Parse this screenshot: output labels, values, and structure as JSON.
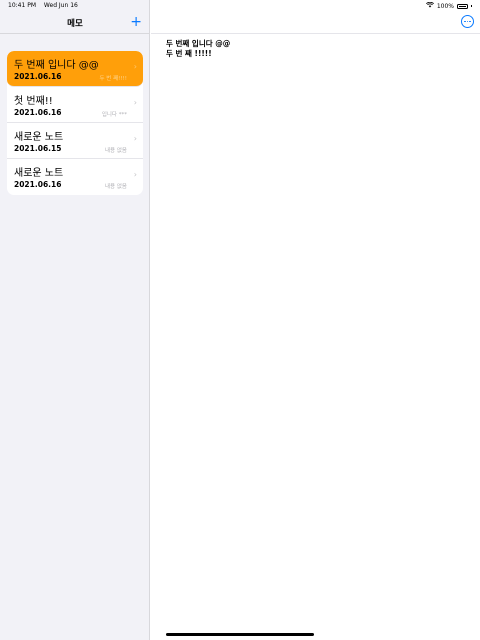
{
  "status": {
    "time": "10:41 PM",
    "date": "Wed Jun 16",
    "battery": "100%"
  },
  "sidebar": {
    "title": "메모",
    "add_icon": "plus-icon"
  },
  "notes": [
    {
      "title": "두 번째 입니다 @@",
      "date": "2021.06.16",
      "preview": "두 번 째!!!!",
      "selected": true
    },
    {
      "title": "첫 번째!!",
      "date": "2021.06.16",
      "preview": "입니다 ***",
      "selected": false
    },
    {
      "title": "새로운 노트",
      "date": "2021.06.15",
      "preview": "내용 없음",
      "selected": false
    },
    {
      "title": "새로운 노트",
      "date": "2021.06.16",
      "preview": "내용 없음",
      "selected": false
    }
  ],
  "detail": {
    "line1": "두 번째 입니다 @@",
    "line2": "두 번 째 !!!!!",
    "more_icon": "ellipsis-circle-icon"
  },
  "colors": {
    "accent": "#0a7aff",
    "selected": "#ff9f0a"
  }
}
